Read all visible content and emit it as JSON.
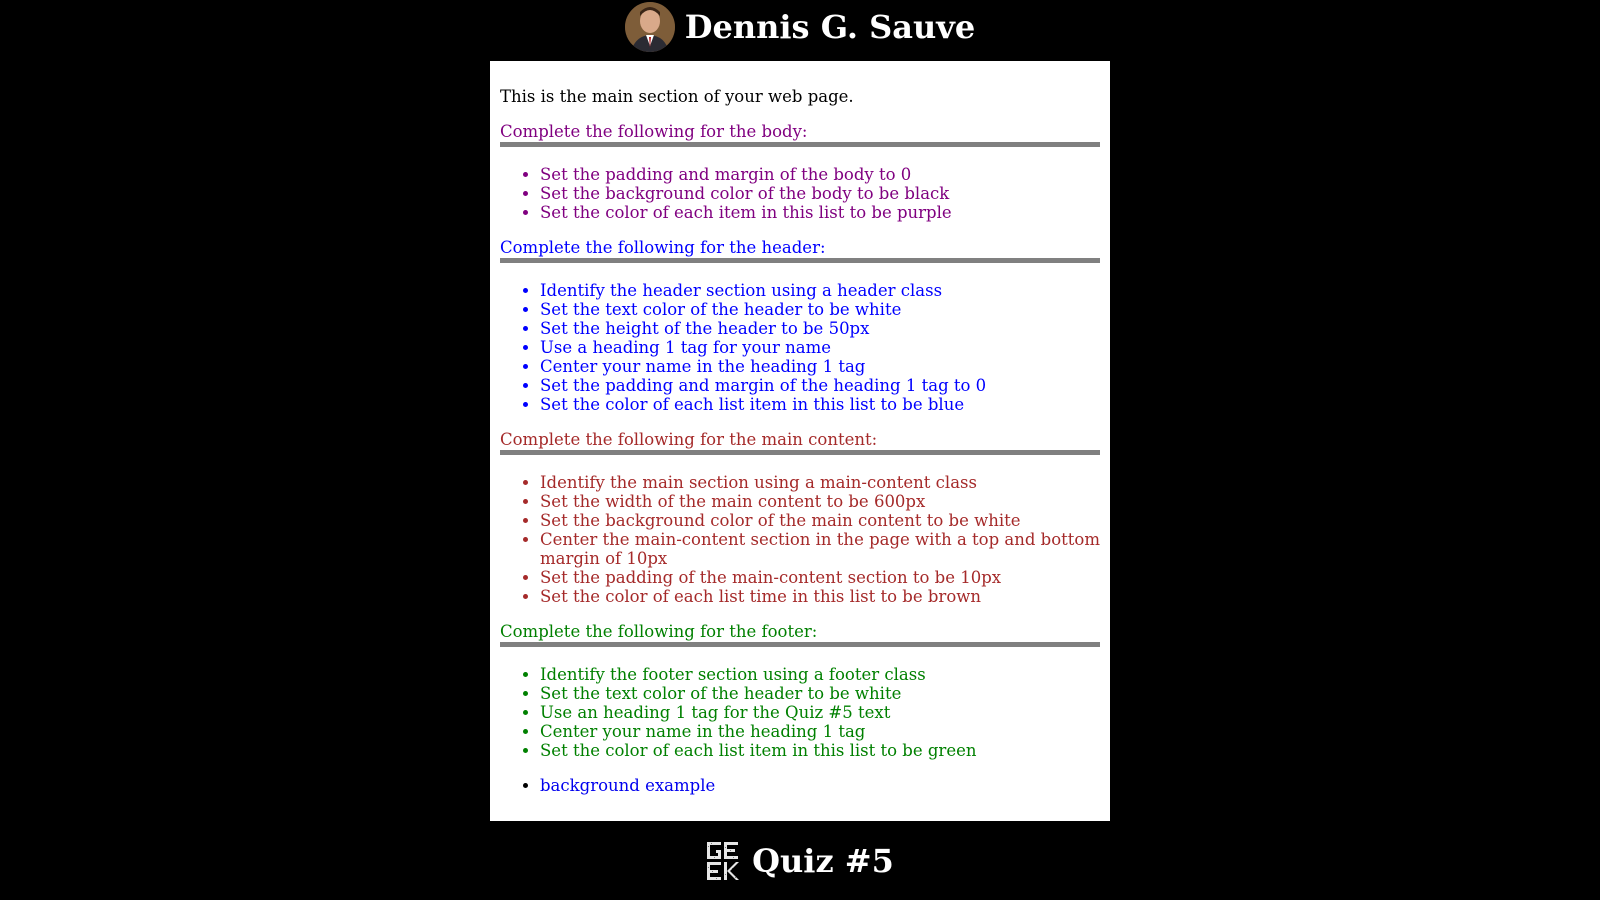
{
  "header": {
    "name": "Dennis G. Sauve"
  },
  "main": {
    "intro": "This is the main section of your web page.",
    "sections": [
      {
        "title": "Complete the following for the body:",
        "items": [
          "Set the padding and margin of the body to 0",
          "Set the background color of the body to be black",
          "Set the color of each item in this list to be purple"
        ]
      },
      {
        "title": "Complete the following for the header:",
        "items": [
          "Identify the header section using a header class",
          "Set the text color of the header to be white",
          "Set the height of the header to be 50px",
          "Use a heading 1 tag for your name",
          "Center your name in the heading 1 tag",
          "Set the padding and margin of the heading 1 tag to 0",
          "Set the color of each list item in this list to be blue"
        ]
      },
      {
        "title": "Complete the following for the main content:",
        "items": [
          "Identify the main section using a main-content class",
          "Set the width of the main content to be 600px",
          "Set the background color of the main content to be white",
          "Center the main-content section in the page with a top and bottom margin of 10px",
          "Set the padding of the main-content section to be 10px",
          "Set the color of each list time in this list to be brown"
        ]
      },
      {
        "title": "Complete the following for the footer:",
        "items": [
          "Identify the footer section using a footer class",
          "Set the text color of the header to be white",
          "Use an heading 1 tag for the Quiz #5 text",
          "Center your name in the heading 1 tag",
          "Set the color of each list item in this list to be green"
        ]
      }
    ],
    "link": "background example"
  },
  "footer": {
    "title": "Quiz #5",
    "logo_text": [
      "GE",
      "EK"
    ]
  },
  "colors": {
    "body_bg": "#000000",
    "main_bg": "#ffffff",
    "purple": "#800080",
    "blue": "#0000ff",
    "brown": "#a52a2a",
    "green": "#008000",
    "rule": "#808080"
  }
}
